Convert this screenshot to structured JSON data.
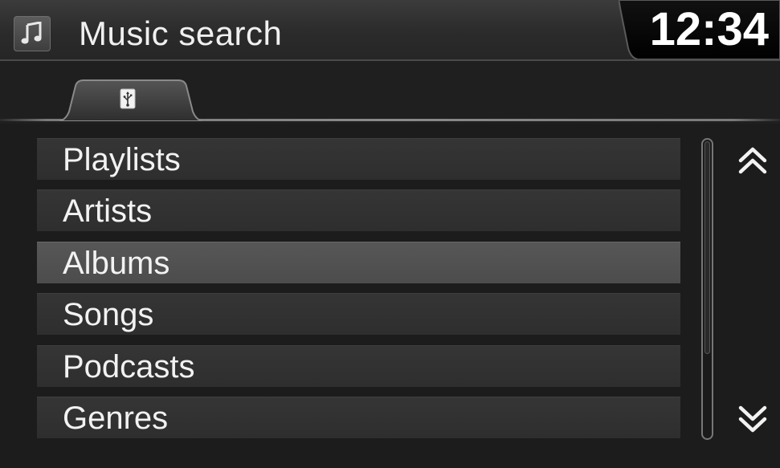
{
  "header": {
    "title": "Music search",
    "clock": "12:34",
    "icon": "music-note-icon"
  },
  "tabs": [
    {
      "icon": "usb-icon",
      "active": true
    }
  ],
  "list": {
    "items": [
      {
        "label": "Playlists",
        "selected": false
      },
      {
        "label": "Artists",
        "selected": false
      },
      {
        "label": "Albums",
        "selected": true
      },
      {
        "label": "Songs",
        "selected": false
      },
      {
        "label": "Podcasts",
        "selected": false
      },
      {
        "label": "Genres",
        "selected": false
      }
    ]
  },
  "scroll": {
    "up_icon": "double-chevron-up-icon",
    "down_icon": "double-chevron-down-icon",
    "thumb_fraction": 0.72
  },
  "colors": {
    "background": "#1c1c1c",
    "item": "#323232",
    "item_selected": "#525252",
    "text": "#f2f2f2"
  }
}
